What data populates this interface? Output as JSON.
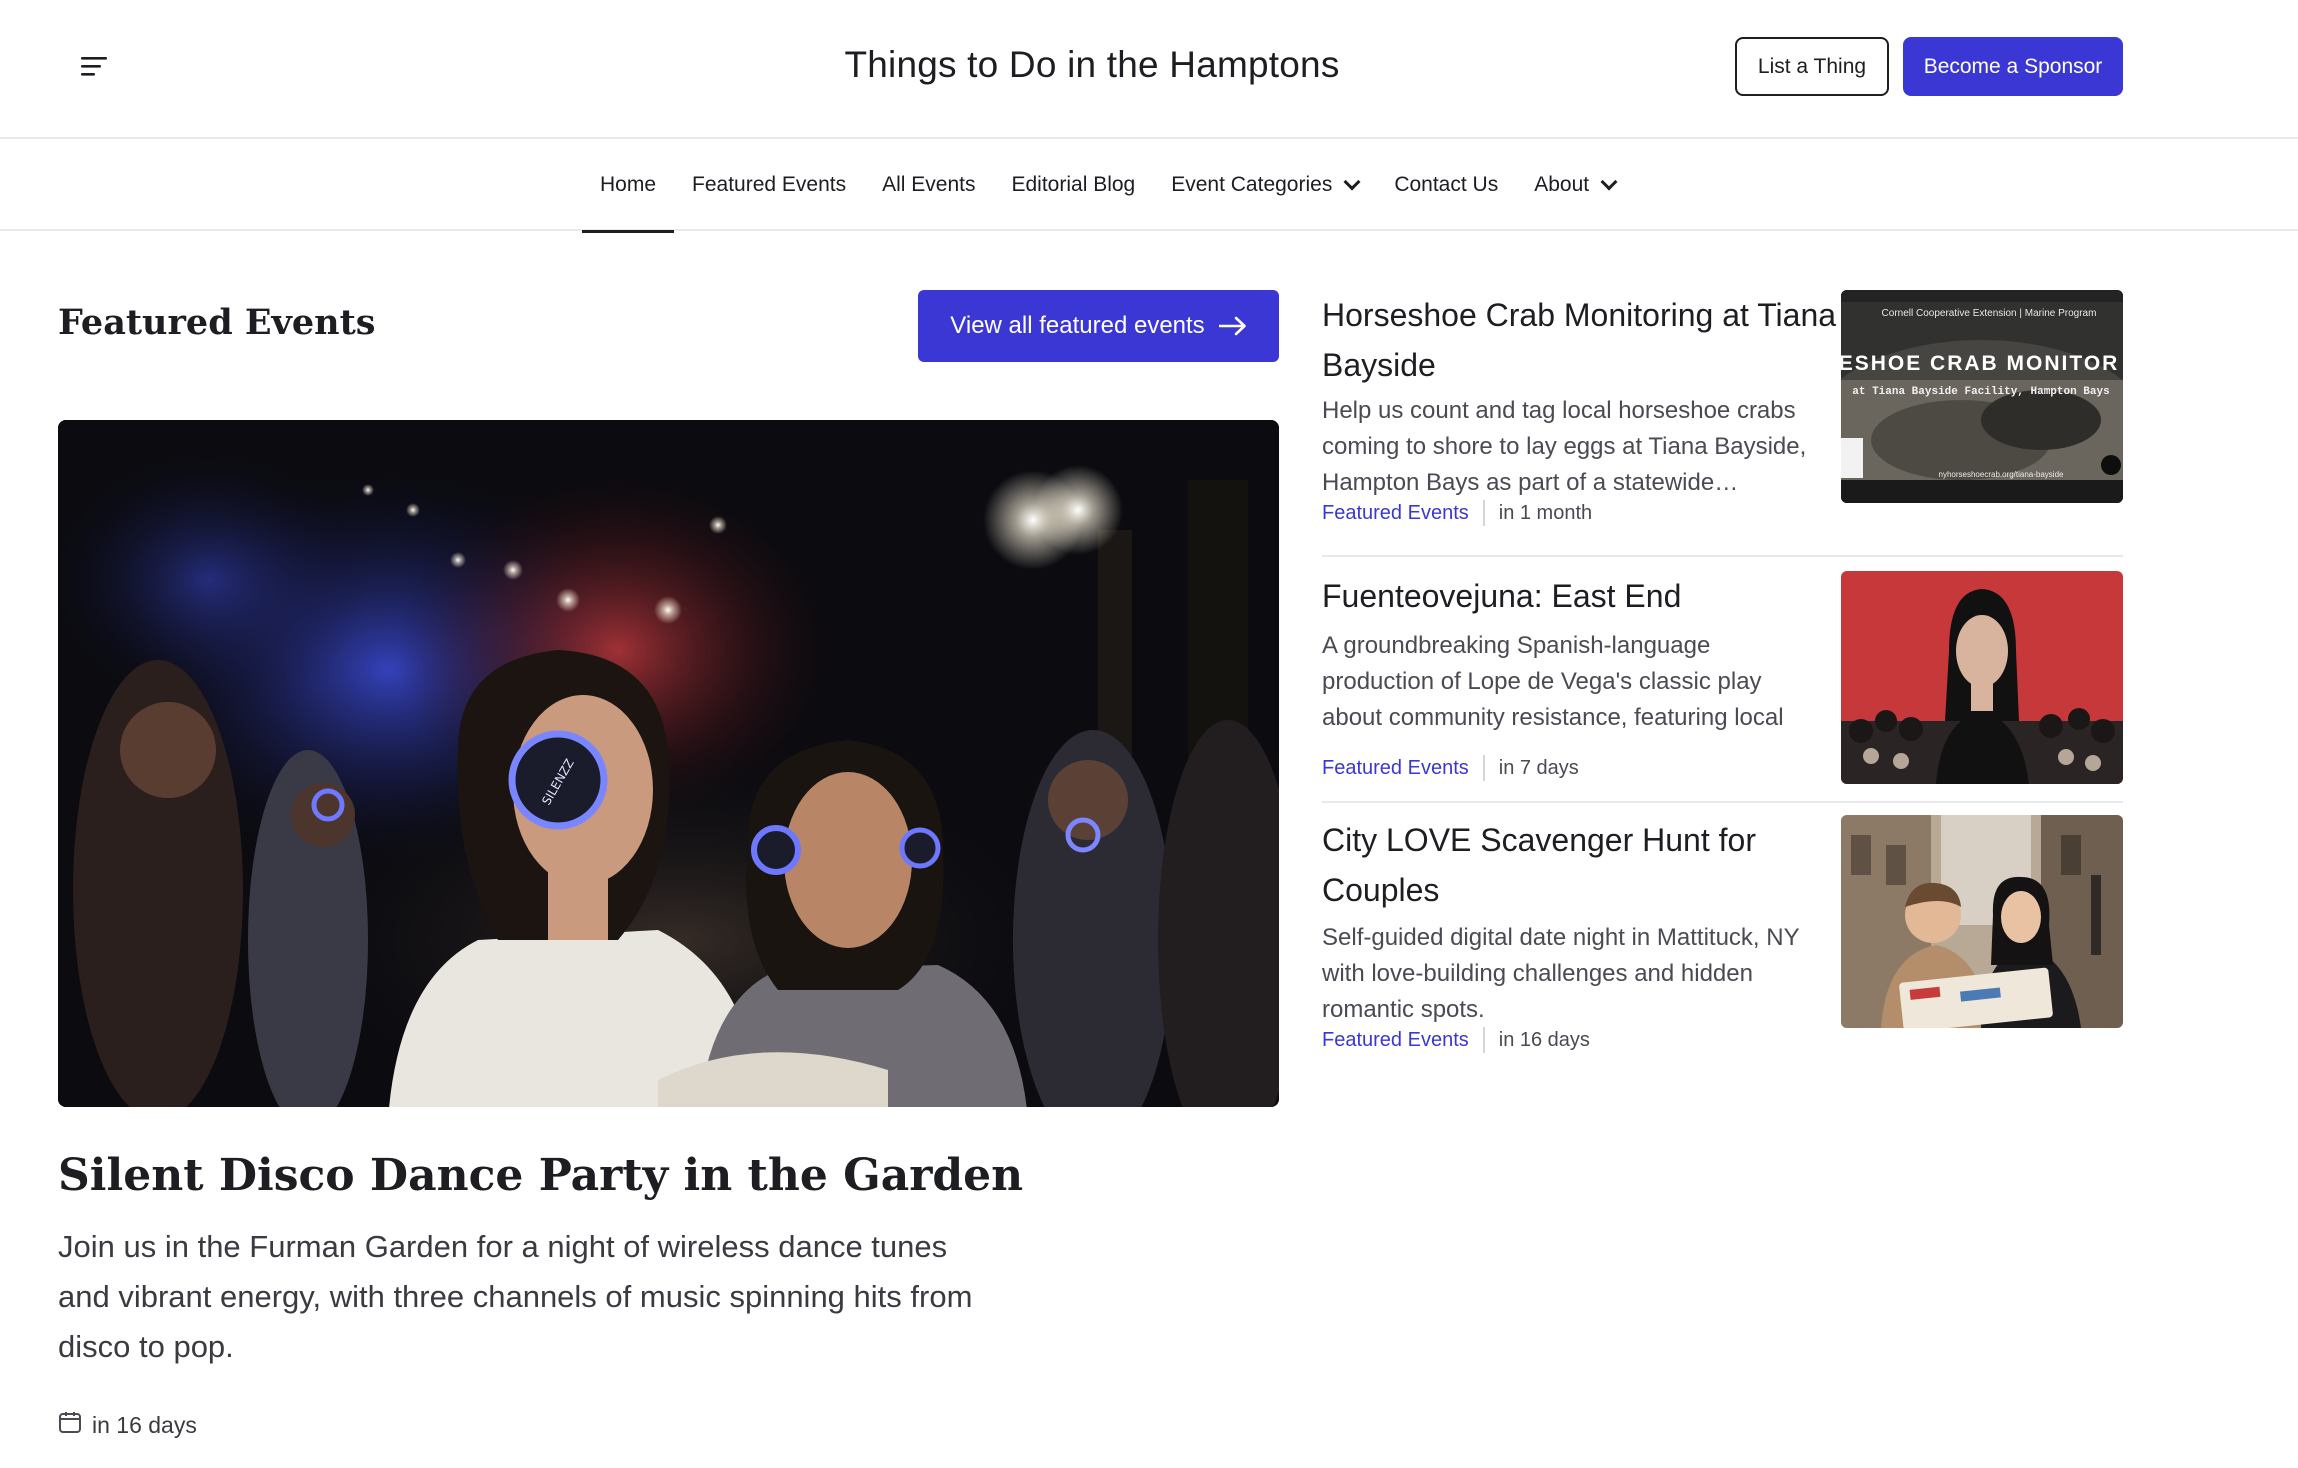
{
  "header": {
    "title": "Things to Do in the Hamptons",
    "list_button": "List a Thing",
    "sponsor_button": "Become a Sponsor"
  },
  "nav": {
    "items": [
      {
        "label": "Home",
        "active": true
      },
      {
        "label": "Featured Events"
      },
      {
        "label": "All Events"
      },
      {
        "label": "Editorial Blog"
      },
      {
        "label": "Event Categories",
        "dropdown": true
      },
      {
        "label": "Contact Us"
      },
      {
        "label": "About",
        "dropdown": true
      }
    ]
  },
  "featured": {
    "section_title": "Featured Events",
    "view_all_label": "View all featured events",
    "hero": {
      "title": "Silent Disco Dance Party in the Garden",
      "description": "Join us in the Furman Garden for a night of wireless dance tunes and vibrant energy, with three channels of music spinning hits from disco to pop.",
      "when": "in 16 days"
    },
    "items": [
      {
        "title": "Horseshoe Crab Monitoring at Tiana Bayside",
        "description": "Help us count and tag local horseshoe crabs coming to shore to lay eggs at Tiana Bayside, Hampton Bays as part of a statewide…",
        "category": "Featured Events",
        "when": "in 1 month",
        "thumb_top_text": "Cornell Cooperative Extension | Marine Program",
        "thumb_main_text": "SESHOE CRAB MONITOR",
        "thumb_sub_text": "at Tiana Bayside Facility, Hampton Bays",
        "thumb_url_text": "nyhorseshoecrab.org/tiana-bayside"
      },
      {
        "title": "Fuenteovejuna: East End",
        "description": "A groundbreaking Spanish-language production of Lope de Vega's classic play about community resistance, featuring local Latino…",
        "category": "Featured Events",
        "when": "in 7 days"
      },
      {
        "title": "City LOVE Scavenger Hunt for Couples",
        "description": "Self-guided digital date night in Mattituck, NY with love-building challenges and hidden romantic spots.",
        "category": "Featured Events",
        "when": "in 16 days"
      }
    ]
  },
  "colors": {
    "accent": "#3b37d4",
    "text": "#1d1d22",
    "muted": "#4a4a52",
    "border": "#e8e8ef"
  }
}
